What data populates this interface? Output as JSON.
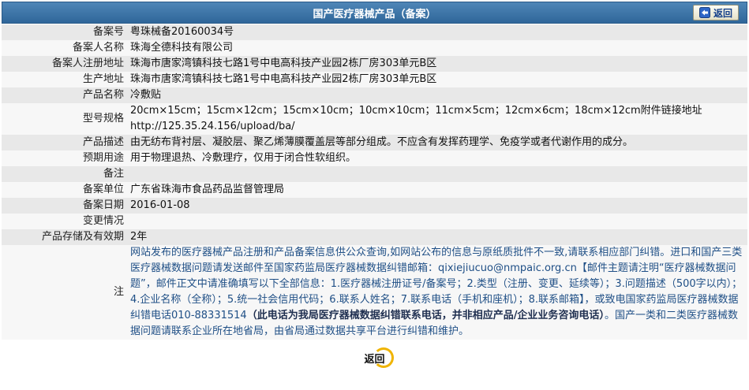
{
  "header": {
    "title": "国产医疗器械产品（备案）",
    "back_label": "返回"
  },
  "rows": [
    {
      "label": "备案号",
      "value": "粤珠械备20160034号"
    },
    {
      "label": "备案人名称",
      "value": "珠海全德科技有限公司"
    },
    {
      "label": "备案人注册地址",
      "value": "珠海市唐家湾镇科技七路1号中电高科技产业园2栋厂房303单元B区"
    },
    {
      "label": "生产地址",
      "value": "珠海市唐家湾镇科技七路1号中电高科技产业园2栋厂房303单元B区"
    },
    {
      "label": "产品名称",
      "value": "冷敷贴"
    },
    {
      "label": "型号规格",
      "value": "20cm×15cm；15cm×12cm；15cm×10cm；10cm×10cm；11cm×5cm；12cm×6cm；18cm×12cm附件链接地址",
      "value2": "http://125.35.24.156/upload/ba/"
    },
    {
      "label": "产品描述",
      "value": "由无纺布背衬层、凝胶层、聚乙烯薄膜覆盖层等部分组成。不应含有发挥药理学、免疫学或者代谢作用的成分。"
    },
    {
      "label": "预期用途",
      "value": "用于物理退热、冷敷理疗，仅用于闭合性软组织。"
    },
    {
      "label": "备注",
      "value": ""
    },
    {
      "label": "备案单位",
      "value": "广东省珠海市食品药品监督管理局"
    },
    {
      "label": "备案日期",
      "value": "2016-01-08"
    },
    {
      "label": "变更情况",
      "value": ""
    },
    {
      "label": "产品存储及有效期",
      "value": "2年"
    }
  ],
  "note": {
    "label": "注",
    "part1": "网站发布的医疗器械产品注册和产品备案信息供公众查询,如网站公布的信息与原纸质批件不一致,请联系相应部门纠错。进口和国产三类医疗器械数据问题请发送邮件至国家药监局医疗器械数据纠错邮箱：qixiejiucuo@nmpaic.org.cn【邮件主题请注明“医疗器械数据问题”，邮件正文中请准确填写以下全部信息：1.医疗器械注册证号/备案号；2.类型（注册、变更、延续等）；3.问题描述（500字以内）；4.企业名称（全称）；5.统一社会信用代码；6.联系人姓名；7.联系电话（手机和座机）；8.联系邮箱】，或致电国家药监局医疗器械数据纠错电话010-88331514",
    "bold": "（此电话为我局医疗器械数据纠错联系电话，并非相应产品/企业业务咨询电话）",
    "part2": "。国产一类和二类医疗器械数据问题请联系企业所在地省局，由省局通过数据共享平台进行纠错和维护。"
  },
  "footer": {
    "back_label": "返回"
  }
}
